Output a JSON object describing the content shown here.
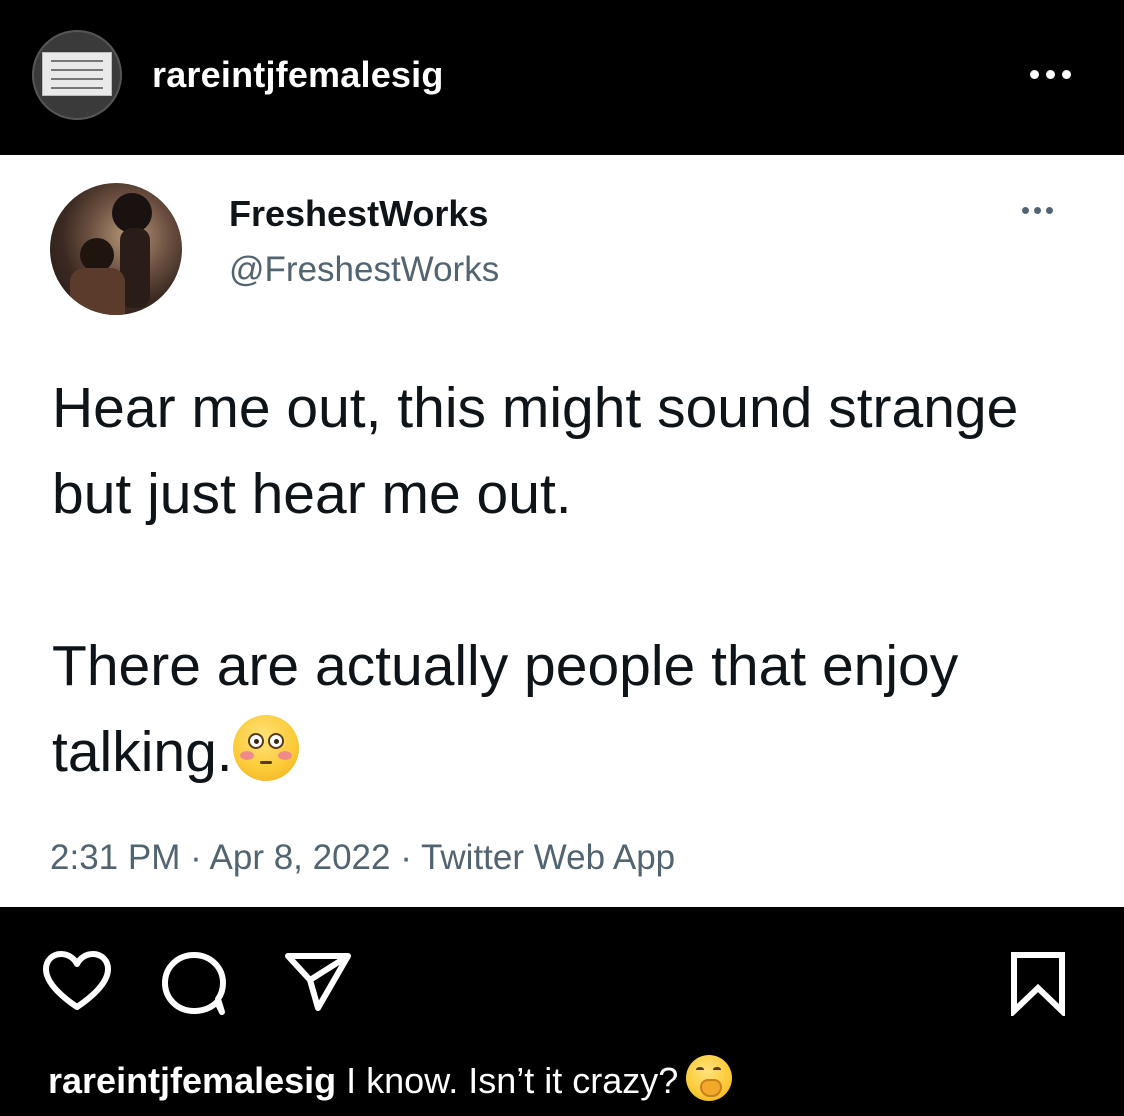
{
  "header": {
    "username": "rareintjfemalesig",
    "avatar_icon": "profile-avatar",
    "more_icon": "more-horizontal-icon"
  },
  "tweet": {
    "display_name": "FreshestWorks",
    "handle": "@FreshestWorks",
    "paragraph_1": "Hear me out, this might sound strange but just hear me out.",
    "paragraph_2": "There are actually people that enjoy talking.",
    "paragraph_2_emoji": "flushed-face",
    "meta": "2:31 PM · Apr 8, 2022 · Twitter Web App",
    "more_icon": "more-horizontal-icon"
  },
  "actions": {
    "like_icon": "heart-icon",
    "comment_icon": "comment-icon",
    "share_icon": "paper-plane-icon",
    "save_icon": "bookmark-icon"
  },
  "caption": {
    "username": "rareintjfemalesig",
    "text": "I know.  Isn’t it crazy?",
    "emoji": "face-with-hand-over-mouth"
  }
}
